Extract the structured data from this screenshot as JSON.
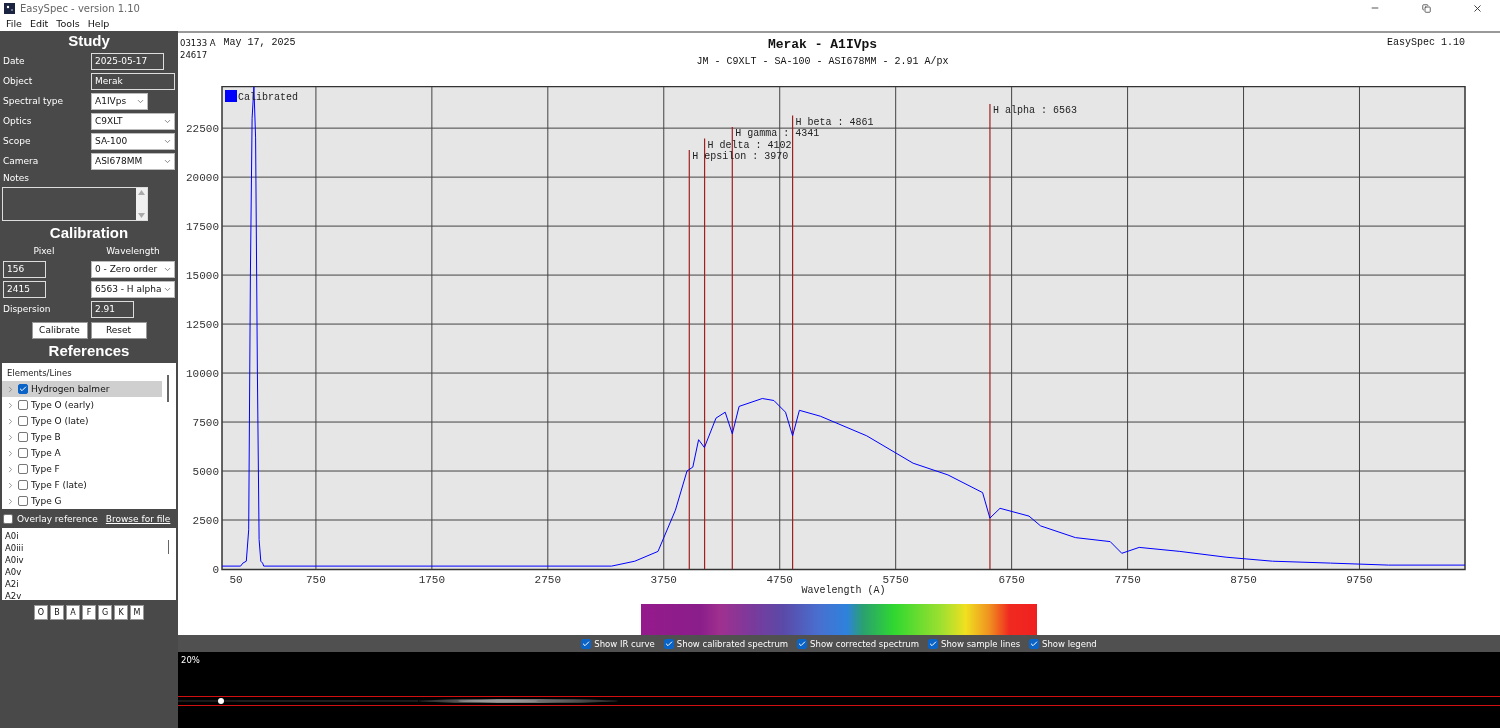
{
  "window": {
    "title": "EasySpec - version 1.10"
  },
  "menu": [
    "File",
    "Edit",
    "Tools",
    "Help"
  ],
  "study": {
    "heading": "Study",
    "fields": [
      {
        "kind": "text",
        "label": "Date",
        "value": "2025-05-17"
      },
      {
        "kind": "text",
        "label": "Object",
        "value": "Merak"
      },
      {
        "kind": "shortselect",
        "label": "Spectral type",
        "value": "A1IVps"
      },
      {
        "kind": "select",
        "label": "Optics",
        "value": "C9XLT"
      },
      {
        "kind": "select",
        "label": "Scope",
        "value": "SA-100"
      },
      {
        "kind": "select",
        "label": "Camera",
        "value": "ASI678MM"
      }
    ],
    "notes_label": "Notes"
  },
  "calibration": {
    "heading": "Calibration",
    "columns": [
      "Pixel",
      "Wavelength"
    ],
    "rows": [
      {
        "pixel": "156",
        "wavelength": "0 - Zero order"
      },
      {
        "pixel": "2415",
        "wavelength": "6563 - H alpha"
      }
    ],
    "dispersion": {
      "label": "Dispersion",
      "value": "2.91"
    },
    "buttons": [
      "Calibrate",
      "Reset"
    ]
  },
  "references": {
    "heading": "References",
    "tree_header": "Elements/Lines",
    "items": [
      {
        "label": "Hydrogen balmer",
        "checked": true,
        "selected": true
      },
      {
        "label": "Type O (early)",
        "checked": false,
        "selected": false
      },
      {
        "label": "Type O (late)",
        "checked": false,
        "selected": false
      },
      {
        "label": "Type B",
        "checked": false,
        "selected": false
      },
      {
        "label": "Type A",
        "checked": false,
        "selected": false
      },
      {
        "label": "Type F",
        "checked": false,
        "selected": false
      },
      {
        "label": "Type F (late)",
        "checked": false,
        "selected": false
      },
      {
        "label": "Type G",
        "checked": false,
        "selected": false
      }
    ],
    "overlay": {
      "label": "Overlay reference",
      "checked": false
    },
    "browse_link": "Browse for file",
    "types": [
      "A0i",
      "A0iii",
      "A0iv",
      "A0v",
      "A2i",
      "A2v"
    ],
    "class_buttons": [
      "O",
      "B",
      "A",
      "F",
      "G",
      "K",
      "M"
    ]
  },
  "chart": {
    "readout": [
      "03133 A",
      "24617"
    ],
    "date": "May 17, 2025",
    "subtitle": "JM - C9XLT - SA-100 - ASI678MM - 2.91 A/px",
    "app_label": "EasySpec 1.10",
    "chart_data": {
      "type": "line",
      "title": "Merak - A1IVps",
      "xlabel": "Wavelength (A)",
      "x": [
        -60,
        100,
        120,
        150,
        170,
        185,
        200,
        215,
        230,
        245,
        260,
        275,
        290,
        300,
        3300,
        3500,
        3700,
        3850,
        3950,
        4000,
        4050,
        4100,
        4200,
        4280,
        4341,
        4400,
        4600,
        4700,
        4800,
        4861,
        4920,
        5100,
        5500,
        5900,
        6200,
        6500,
        6563,
        6650,
        6900,
        7000,
        7300,
        7600,
        7700,
        7850,
        8200,
        8600,
        9000,
        9500,
        10000,
        10660
      ],
      "series": [
        {
          "name": "Calibrated",
          "color": "#0000ff",
          "values": [
            150,
            150,
            300,
            400,
            2000,
            15000,
            23000,
            24600,
            22000,
            10000,
            1500,
            400,
            300,
            150,
            150,
            400,
            900,
            3000,
            5000,
            5200,
            6600,
            6200,
            7700,
            8000,
            6900,
            8300,
            8700,
            8600,
            8000,
            6800,
            8100,
            7800,
            6800,
            5400,
            4800,
            3900,
            2600,
            3100,
            2700,
            2200,
            1600,
            1400,
            800,
            1100,
            900,
            600,
            400,
            300,
            200,
            200
          ]
        }
      ],
      "xlim": [
        -60,
        10660
      ],
      "ylim": [
        0,
        24650
      ],
      "xticks": [
        50,
        750,
        1750,
        2750,
        3750,
        4750,
        5750,
        6750,
        7750,
        8750,
        9750
      ],
      "yticks": [
        0,
        2500,
        5000,
        7500,
        10000,
        12500,
        15000,
        17500,
        20000,
        22500
      ],
      "grid": true,
      "ref_lines": [
        {
          "axis": "x",
          "value": 3970
        },
        {
          "axis": "x",
          "value": 4102
        },
        {
          "axis": "x",
          "value": 4341
        },
        {
          "axis": "x",
          "value": 4861
        },
        {
          "axis": "x",
          "value": 6563
        }
      ],
      "annotations": [
        "H epsilon : 3970",
        "H delta : 4102",
        "H gamma : 4341",
        "H beta : 4861",
        "H alpha : 6563"
      ]
    }
  },
  "options": [
    {
      "label": "Show IR curve",
      "checked": true
    },
    {
      "label": "Show calibrated spectrum",
      "checked": true
    },
    {
      "label": "Show corrected spectrum",
      "checked": true
    },
    {
      "label": "Show sample lines",
      "checked": true
    },
    {
      "label": "Show legend",
      "checked": true
    }
  ],
  "image_view": {
    "zoom": "20%"
  }
}
